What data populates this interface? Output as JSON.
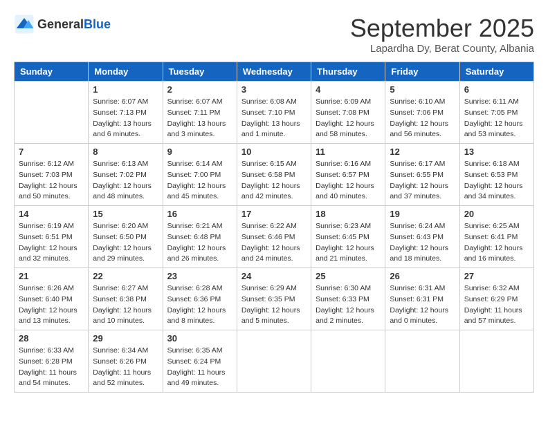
{
  "header": {
    "logo_general": "General",
    "logo_blue": "Blue",
    "month_title": "September 2025",
    "subtitle": "Lapardha Dy, Berat County, Albania"
  },
  "days_of_week": [
    "Sunday",
    "Monday",
    "Tuesday",
    "Wednesday",
    "Thursday",
    "Friday",
    "Saturday"
  ],
  "weeks": [
    [
      {
        "day": null,
        "info": null
      },
      {
        "day": "1",
        "sunrise": "6:07 AM",
        "sunset": "7:13 PM",
        "daylight": "13 hours and 6 minutes."
      },
      {
        "day": "2",
        "sunrise": "6:07 AM",
        "sunset": "7:11 PM",
        "daylight": "13 hours and 3 minutes."
      },
      {
        "day": "3",
        "sunrise": "6:08 AM",
        "sunset": "7:10 PM",
        "daylight": "13 hours and 1 minute."
      },
      {
        "day": "4",
        "sunrise": "6:09 AM",
        "sunset": "7:08 PM",
        "daylight": "12 hours and 58 minutes."
      },
      {
        "day": "5",
        "sunrise": "6:10 AM",
        "sunset": "7:06 PM",
        "daylight": "12 hours and 56 minutes."
      },
      {
        "day": "6",
        "sunrise": "6:11 AM",
        "sunset": "7:05 PM",
        "daylight": "12 hours and 53 minutes."
      }
    ],
    [
      {
        "day": "7",
        "sunrise": "6:12 AM",
        "sunset": "7:03 PM",
        "daylight": "12 hours and 50 minutes."
      },
      {
        "day": "8",
        "sunrise": "6:13 AM",
        "sunset": "7:02 PM",
        "daylight": "12 hours and 48 minutes."
      },
      {
        "day": "9",
        "sunrise": "6:14 AM",
        "sunset": "7:00 PM",
        "daylight": "12 hours and 45 minutes."
      },
      {
        "day": "10",
        "sunrise": "6:15 AM",
        "sunset": "6:58 PM",
        "daylight": "12 hours and 42 minutes."
      },
      {
        "day": "11",
        "sunrise": "6:16 AM",
        "sunset": "6:57 PM",
        "daylight": "12 hours and 40 minutes."
      },
      {
        "day": "12",
        "sunrise": "6:17 AM",
        "sunset": "6:55 PM",
        "daylight": "12 hours and 37 minutes."
      },
      {
        "day": "13",
        "sunrise": "6:18 AM",
        "sunset": "6:53 PM",
        "daylight": "12 hours and 34 minutes."
      }
    ],
    [
      {
        "day": "14",
        "sunrise": "6:19 AM",
        "sunset": "6:51 PM",
        "daylight": "12 hours and 32 minutes."
      },
      {
        "day": "15",
        "sunrise": "6:20 AM",
        "sunset": "6:50 PM",
        "daylight": "12 hours and 29 minutes."
      },
      {
        "day": "16",
        "sunrise": "6:21 AM",
        "sunset": "6:48 PM",
        "daylight": "12 hours and 26 minutes."
      },
      {
        "day": "17",
        "sunrise": "6:22 AM",
        "sunset": "6:46 PM",
        "daylight": "12 hours and 24 minutes."
      },
      {
        "day": "18",
        "sunrise": "6:23 AM",
        "sunset": "6:45 PM",
        "daylight": "12 hours and 21 minutes."
      },
      {
        "day": "19",
        "sunrise": "6:24 AM",
        "sunset": "6:43 PM",
        "daylight": "12 hours and 18 minutes."
      },
      {
        "day": "20",
        "sunrise": "6:25 AM",
        "sunset": "6:41 PM",
        "daylight": "12 hours and 16 minutes."
      }
    ],
    [
      {
        "day": "21",
        "sunrise": "6:26 AM",
        "sunset": "6:40 PM",
        "daylight": "12 hours and 13 minutes."
      },
      {
        "day": "22",
        "sunrise": "6:27 AM",
        "sunset": "6:38 PM",
        "daylight": "12 hours and 10 minutes."
      },
      {
        "day": "23",
        "sunrise": "6:28 AM",
        "sunset": "6:36 PM",
        "daylight": "12 hours and 8 minutes."
      },
      {
        "day": "24",
        "sunrise": "6:29 AM",
        "sunset": "6:35 PM",
        "daylight": "12 hours and 5 minutes."
      },
      {
        "day": "25",
        "sunrise": "6:30 AM",
        "sunset": "6:33 PM",
        "daylight": "12 hours and 2 minutes."
      },
      {
        "day": "26",
        "sunrise": "6:31 AM",
        "sunset": "6:31 PM",
        "daylight": "12 hours and 0 minutes."
      },
      {
        "day": "27",
        "sunrise": "6:32 AM",
        "sunset": "6:29 PM",
        "daylight": "11 hours and 57 minutes."
      }
    ],
    [
      {
        "day": "28",
        "sunrise": "6:33 AM",
        "sunset": "6:28 PM",
        "daylight": "11 hours and 54 minutes."
      },
      {
        "day": "29",
        "sunrise": "6:34 AM",
        "sunset": "6:26 PM",
        "daylight": "11 hours and 52 minutes."
      },
      {
        "day": "30",
        "sunrise": "6:35 AM",
        "sunset": "6:24 PM",
        "daylight": "11 hours and 49 minutes."
      },
      {
        "day": null,
        "info": null
      },
      {
        "day": null,
        "info": null
      },
      {
        "day": null,
        "info": null
      },
      {
        "day": null,
        "info": null
      }
    ]
  ],
  "labels": {
    "sunrise_prefix": "Sunrise: ",
    "sunset_prefix": "Sunset: ",
    "daylight_prefix": "Daylight: "
  }
}
